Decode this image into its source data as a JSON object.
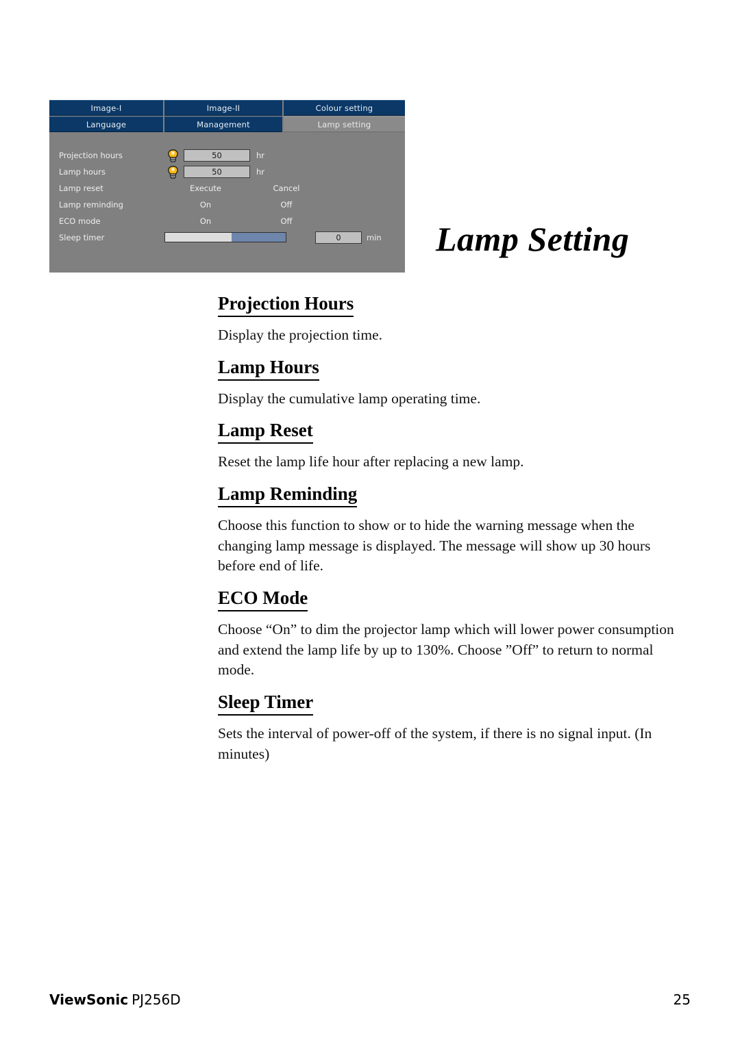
{
  "osd": {
    "tabs_row1": [
      {
        "label": "Image-I",
        "active": false
      },
      {
        "label": "Image-II",
        "active": false
      },
      {
        "label": "Colour setting",
        "active": false
      }
    ],
    "tabs_row2": [
      {
        "label": "Language",
        "active": false
      },
      {
        "label": "Management",
        "active": false
      },
      {
        "label": "Lamp setting",
        "active": true
      }
    ],
    "rows": [
      {
        "label": "Projection hours",
        "value": "50",
        "unit": "hr",
        "icon": "lamp-bulb-icon"
      },
      {
        "label": "Lamp hours",
        "value": "50",
        "unit": "hr",
        "icon": "lamp-bulb-icon"
      },
      {
        "label": "Lamp reset",
        "option_a": "Execute",
        "option_b": "Cancel"
      },
      {
        "label": "Lamp reminding",
        "option_a": "On",
        "option_b": "Off"
      },
      {
        "label": "ECO mode",
        "option_a": "On",
        "option_b": "Off"
      },
      {
        "label": "Sleep timer",
        "slider_percent": 55,
        "value": "0",
        "unit": "min"
      }
    ],
    "colors": {
      "tab_inactive_bg": "#0b3866",
      "tab_active_bg": "#8a8a8a",
      "panel_bg": "#808080",
      "value_box_bg": "#c0c0c0",
      "slider_fill": "#6e86ab",
      "bulb_yellow": "#f5b814"
    }
  },
  "page_title": "Lamp Setting",
  "sections": [
    {
      "heading": "Projection Hours",
      "body": "Display the projection time."
    },
    {
      "heading": "Lamp Hours",
      "body": "Display the cumulative lamp operating time."
    },
    {
      "heading": "Lamp Reset",
      "body": "Reset the lamp life hour after replacing a new lamp."
    },
    {
      "heading": "Lamp Reminding",
      "body": "Choose this function to show or to hide the warning message when the changing lamp message is displayed. The message will show up 30 hours before end of life."
    },
    {
      "heading": "ECO Mode",
      "body": "Choose “On” to dim the projector lamp which will lower power consumption and extend the lamp life by up to 130%. Choose ”Off” to return to normal mode."
    },
    {
      "heading": "Sleep Timer",
      "body": "Sets the interval of power-off of the system, if there is no signal input. (In minutes)"
    }
  ],
  "footer": {
    "brand": "ViewSonic",
    "model": "PJ256D",
    "page_number": "25"
  }
}
